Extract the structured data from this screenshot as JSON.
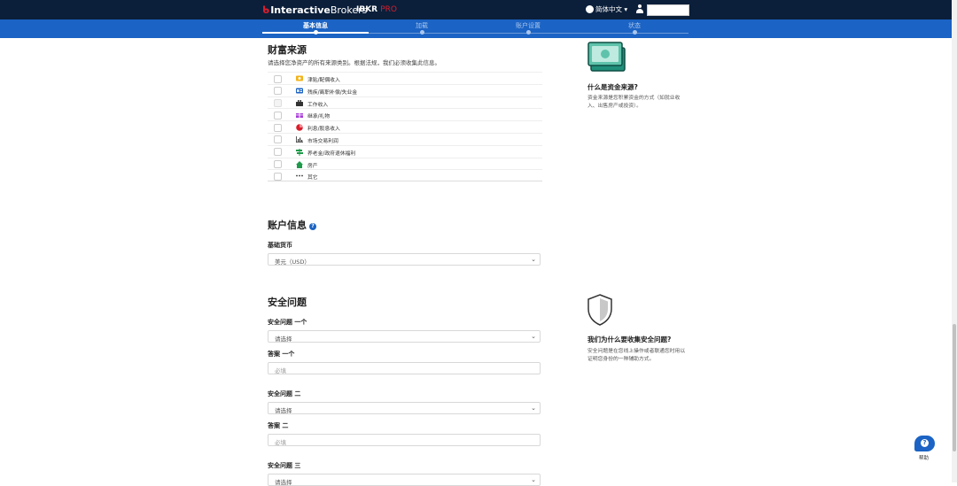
{
  "header": {
    "logo_part1": "Interactive",
    "logo_part2": "Brokers",
    "product_a": "IBKR ",
    "product_b": "PRO",
    "language": "简体中文 ▾"
  },
  "steps": [
    {
      "label": "基本信息",
      "active": true
    },
    {
      "label": "加载",
      "active": false
    },
    {
      "label": "账户设置",
      "active": false
    },
    {
      "label": "状态",
      "active": false
    }
  ],
  "wealth": {
    "title": "财富来源",
    "subtitle": "请选择您净资产的所有来源类别。根据法规，我们必须收集此信息。",
    "items": [
      {
        "label": "津贴/配偶收入",
        "icon": "coin-icon",
        "color": "#f2b31b"
      },
      {
        "label": "残疾/离职补偿/失业金",
        "icon": "id-card-icon",
        "color": "#1b63c4"
      },
      {
        "label": "工作收入",
        "icon": "briefcase-icon",
        "color": "#333333"
      },
      {
        "label": "继承/礼物",
        "icon": "gift-icon",
        "color": "#a83ad9"
      },
      {
        "label": "利息/股息收入",
        "icon": "pie-chart-icon",
        "color": "#d81e2c"
      },
      {
        "label": "市场交易利润",
        "icon": "bar-chart-icon",
        "color": "#333333"
      },
      {
        "label": "养老金/政府退休福利",
        "icon": "signpost-icon",
        "color": "#1f9a4a"
      },
      {
        "label": "房产",
        "icon": "house-icon",
        "color": "#1f9a4a"
      },
      {
        "label": "其它",
        "icon": "more-icon",
        "color": "#333333"
      }
    ]
  },
  "account": {
    "title": "账户信息",
    "base_currency_label": "基础货币",
    "base_currency_value": "美元（USD）"
  },
  "security": {
    "title": "安全问题",
    "q1_label": "安全问题 一个",
    "q1_value": "请选择",
    "a1_label": "答案 一个",
    "a1_placeholder": "必填",
    "q2_label": "安全问题 二",
    "q2_value": "请选择",
    "a2_label": "答案 二",
    "a2_placeholder": "必填",
    "q3_label": "安全问题 三",
    "q3_value": "请选择"
  },
  "side": {
    "wealth_title": "什么是资金来源?",
    "wealth_text": "资金来源是您积累资金的方式（如就业收入、出售房产或投资）。",
    "security_title": "我们为什么要收集安全问题?",
    "security_text": "安全问题是在您线上操作或者联通您时用以证明您身份的一种辅助方式。"
  },
  "help_label": "帮助",
  "colors": {
    "nav_bg": "#0b1f3a",
    "step_bg": "#1b63c4",
    "brand_red": "#d81e2c",
    "side_icon_green": "#1f8f7a"
  }
}
